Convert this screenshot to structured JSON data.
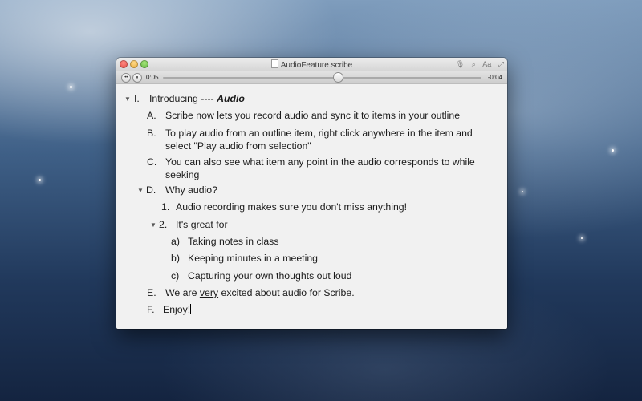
{
  "window": {
    "title": "AudioFeature.scribe",
    "toolbar_icons": {
      "mic": "🎙",
      "search": "⌕",
      "font": "Aa",
      "fullscreen": "⤢"
    }
  },
  "player": {
    "rewind_icon": "⏮",
    "pause_icon": "⏸",
    "elapsed": "0:05",
    "remaining": "-0:04",
    "progress": 0.55
  },
  "outline": {
    "i": {
      "marker": "I.",
      "prefix": "Introducing ---- ",
      "emph": "Audio"
    },
    "a": {
      "marker": "A.",
      "text": "Scribe now lets you record audio and sync it to items in your outline"
    },
    "b": {
      "marker": "B.",
      "line1": "To play audio from an outline item, right click anywhere in the item and",
      "line2": "select \"Play audio from selection\""
    },
    "c": {
      "marker": "C.",
      "line1": "You can also see what item any point in the audio corresponds to while",
      "line2": "seeking"
    },
    "d": {
      "marker": "D.",
      "text": "Why audio?"
    },
    "d1": {
      "marker": "1.",
      "text": "Audio recording makes sure you don't miss anything!"
    },
    "d2": {
      "marker": "2.",
      "text": "It's great for"
    },
    "d2a": {
      "marker": "a)",
      "text": "Taking notes in class"
    },
    "d2b": {
      "marker": "b)",
      "text": "Keeping minutes in a meeting"
    },
    "d2c": {
      "marker": "c)",
      "text": "Capturing your own thoughts out loud"
    },
    "e": {
      "marker": "E.",
      "pre": "We are ",
      "emph": "very",
      "post": " excited about audio for Scribe."
    },
    "f": {
      "marker": "F.",
      "text": "Enjoy!"
    },
    "triangle": "▼"
  }
}
